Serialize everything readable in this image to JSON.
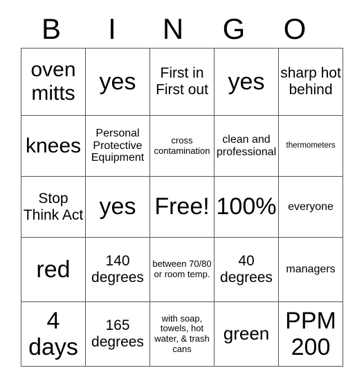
{
  "card": {
    "title": "BINGO",
    "headers": [
      "B",
      "I",
      "N",
      "G",
      "O"
    ],
    "free_space_label": "Free!",
    "colors": {
      "text": "#000000",
      "grid_line": "#555555",
      "background": "#ffffff"
    },
    "rows": [
      [
        {
          "text": "oven mitts",
          "size": "fs-xl"
        },
        {
          "text": "yes",
          "size": "fs-xxl"
        },
        {
          "text": "First in First out",
          "size": "fs-m"
        },
        {
          "text": "yes",
          "size": "fs-xxl"
        },
        {
          "text": "sharp hot behind",
          "size": "fs-m"
        }
      ],
      [
        {
          "text": "knees",
          "size": "fs-xl"
        },
        {
          "text": "Personal Protective Equipment",
          "size": "fs-s"
        },
        {
          "text": "cross contamination",
          "size": "fs-xs"
        },
        {
          "text": "clean and professional",
          "size": "fs-s"
        },
        {
          "text": "thermometers",
          "size": "fs-xxs"
        }
      ],
      [
        {
          "text": "Stop Think Act",
          "size": "fs-m"
        },
        {
          "text": "yes",
          "size": "fs-xxl"
        },
        {
          "text": "Free!",
          "size": "fs-xxl"
        },
        {
          "text": "100%",
          "size": "fs-xxl"
        },
        {
          "text": "everyone",
          "size": "fs-s"
        }
      ],
      [
        {
          "text": "red",
          "size": "fs-xxl"
        },
        {
          "text": "140 degrees",
          "size": "fs-m"
        },
        {
          "text": "between 70/80 or room temp.",
          "size": "fs-xs"
        },
        {
          "text": "40 degrees",
          "size": "fs-m"
        },
        {
          "text": "managers",
          "size": "fs-s"
        }
      ],
      [
        {
          "text": "4 days",
          "size": "fs-xxl"
        },
        {
          "text": "165 degrees",
          "size": "fs-m"
        },
        {
          "text": "with soap, towels, hot water, & trash cans",
          "size": "fs-xs"
        },
        {
          "text": "green",
          "size": "fs-l"
        },
        {
          "text": "PPM 200",
          "size": "fs-xxl"
        }
      ]
    ]
  }
}
